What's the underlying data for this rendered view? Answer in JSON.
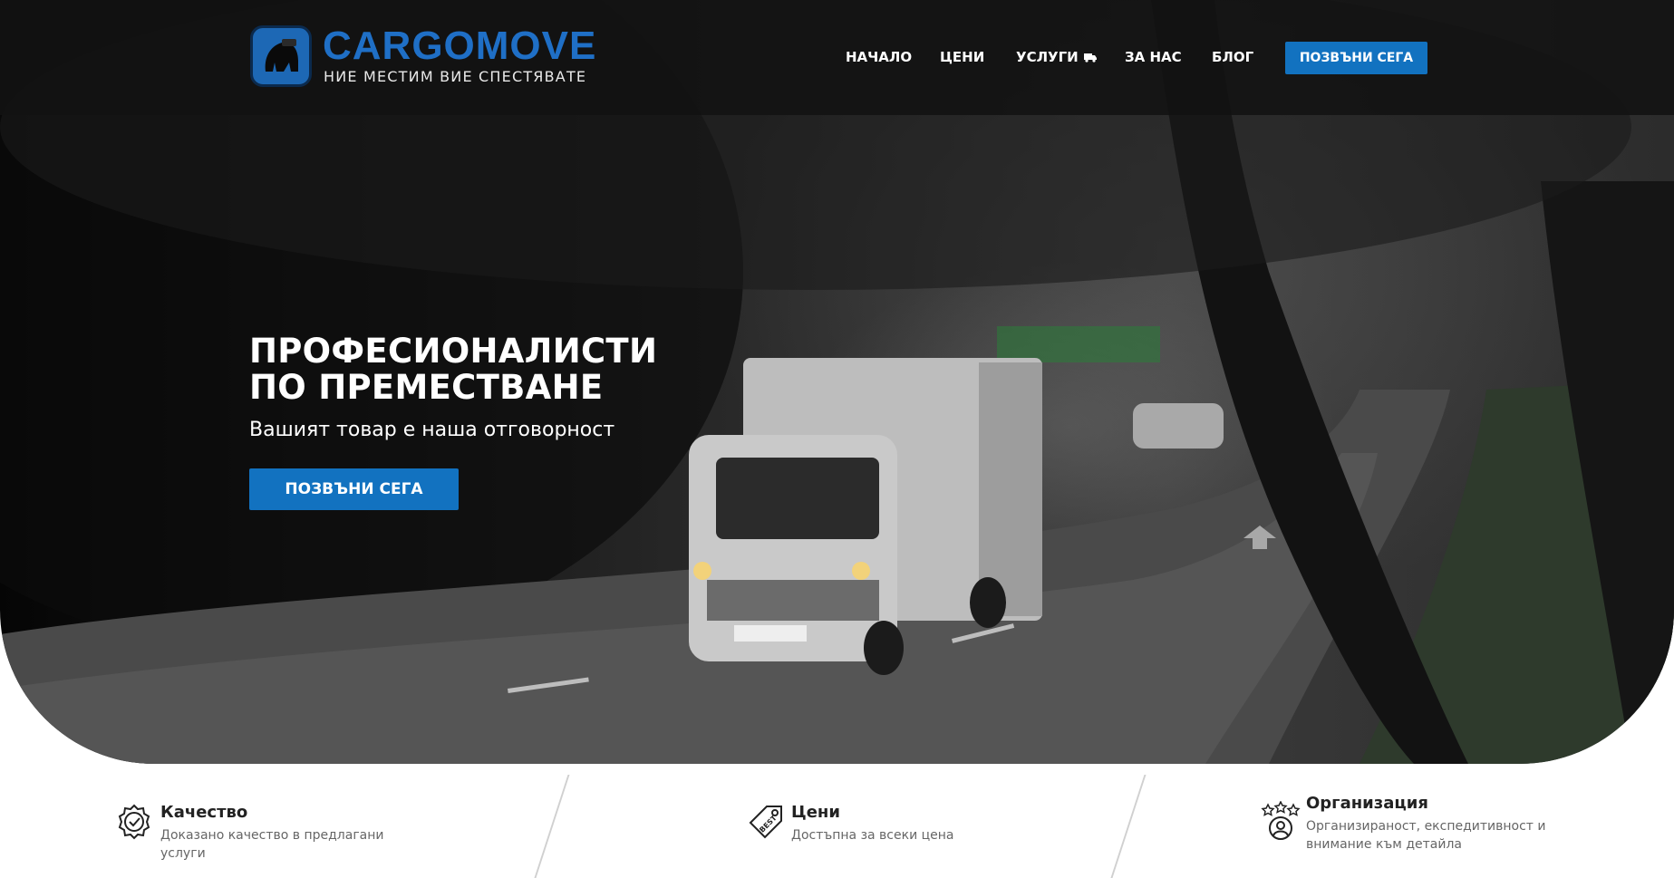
{
  "brand": {
    "name": "CARGOMOVE",
    "tagline": "НИЕ МЕСТИМ ВИЕ СПЕСТЯВАТЕ"
  },
  "nav": {
    "items": [
      {
        "label": "НАЧАЛО"
      },
      {
        "label": "ЦЕНИ"
      },
      {
        "label": "УСЛУГИ"
      },
      {
        "label": "ЗА НАС"
      },
      {
        "label": "БЛОГ"
      }
    ],
    "cta_label": "ПОЗВЪНИ СЕГА"
  },
  "hero": {
    "title_line1": "ПРОФЕСИОНАЛИСТИ",
    "title_line2": "ПО ПРЕМЕСТВАНЕ",
    "subtitle": "Вашият товар е наша отговорност",
    "cta_label": "ПОЗВЪНИ СЕГА"
  },
  "features": [
    {
      "icon": "quality-badge-icon",
      "title": "Качество",
      "description": "Доказано качество в предлагани услуги"
    },
    {
      "icon": "best-price-tag-icon",
      "title": "Цени",
      "description": "Достъпна за всеки цена"
    },
    {
      "icon": "stars-user-icon",
      "title": "Организация",
      "description": "Организираност, експедитивност и внимание към детайла"
    }
  ],
  "colors": {
    "accent": "#1272c0",
    "brand_blue": "#1f6fc6",
    "header_bg": "#121212"
  }
}
